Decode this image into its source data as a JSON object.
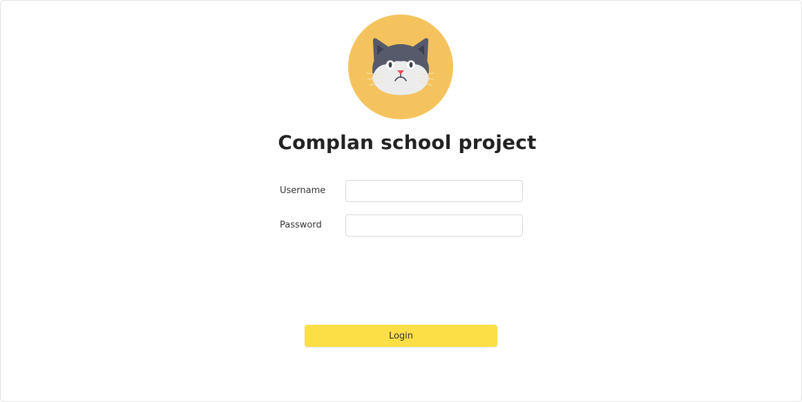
{
  "app": {
    "title": "Complan school project",
    "logo_icon": "cat-face-icon"
  },
  "form": {
    "username_label": "Username",
    "username_value": "",
    "username_placeholder": "",
    "password_label": "Password",
    "password_value": "",
    "password_placeholder": "",
    "login_label": "Login"
  },
  "colors": {
    "accent": "#fcdf47",
    "logo_background": "#f5c35e",
    "cat_fur": "#565a6b",
    "cat_face_white": "#ececec",
    "cat_nose": "#f0485a"
  }
}
